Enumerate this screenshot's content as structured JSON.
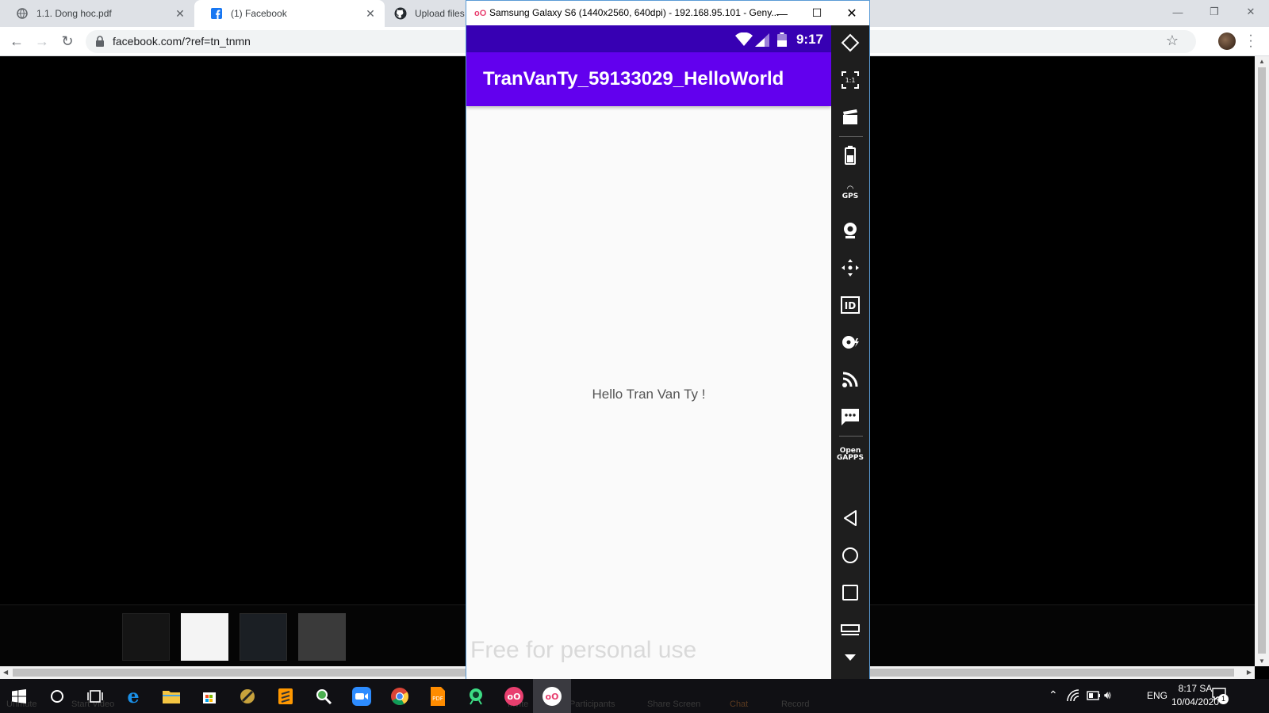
{
  "browser": {
    "tabs": [
      {
        "title": "1.1. Dong hoc.pdf",
        "icon": "globe-icon"
      },
      {
        "title": "(1) Facebook",
        "icon": "facebook-icon"
      },
      {
        "title": "Upload files",
        "icon": "github-icon"
      }
    ],
    "url": "facebook.com/?ref=tn_tnmn"
  },
  "emulator": {
    "window_title": "Samsung Galaxy S6 (1440x2560, 640dpi) - 192.168.95.101 - Geny...",
    "status_time": "9:17",
    "app_title": "TranVanTy_59133029_HelloWorld",
    "hello_text": "Hello Tran Van Ty !",
    "watermark": "Free for personal use",
    "toolbar": [
      "rotate-icon",
      "pixel-perfect-icon",
      "capture-icon",
      "battery-icon",
      "gps-icon",
      "camera-icon",
      "move-icon",
      "device-id-icon",
      "disk-io-icon",
      "cast-icon",
      "sms-icon",
      "open-gapps-icon",
      "back-icon",
      "home-icon",
      "recents-icon",
      "menu-icon",
      "more-icon"
    ],
    "gps_label": "GPS",
    "gapps_label": "Open\nGAPPS"
  },
  "zoom_bar": {
    "labels": [
      "Unmute",
      "Start Video",
      "Invite",
      "Participants",
      "Share Screen",
      "Chat",
      "Record"
    ]
  },
  "taskbar": {
    "language": "ENG",
    "time": "8:17 SA",
    "date": "10/04/2020",
    "notification_count": "1"
  },
  "colors": {
    "status_bar": "#3700b3",
    "app_bar": "#6200ee",
    "taskbar": "#101014"
  }
}
